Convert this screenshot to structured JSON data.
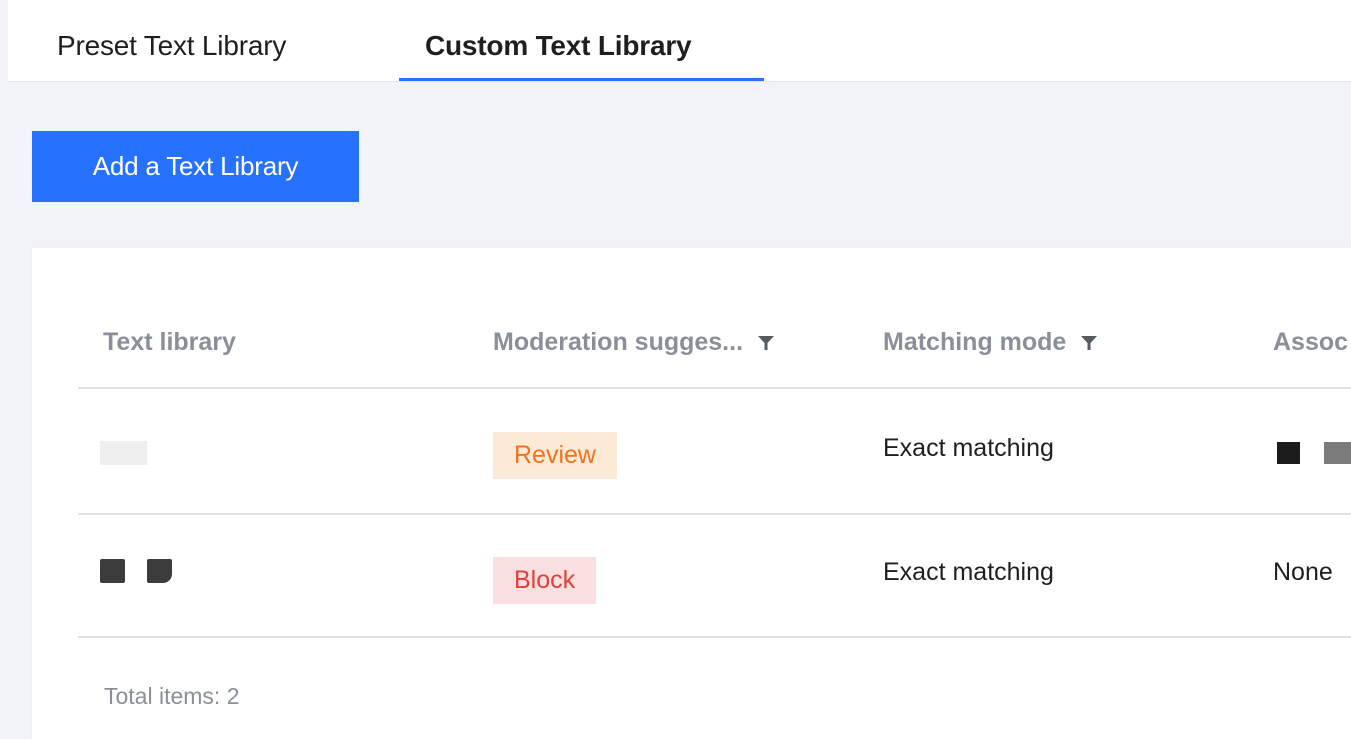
{
  "tabs": [
    {
      "label": "Preset Text Library",
      "active": false
    },
    {
      "label": "Custom Text Library",
      "active": true
    }
  ],
  "toolbar": {
    "add_label": "Add a Text Library"
  },
  "table": {
    "columns": [
      {
        "label": "Text library",
        "filterable": false
      },
      {
        "label": "Moderation sugges...",
        "filterable": true
      },
      {
        "label": "Matching mode",
        "filterable": true
      },
      {
        "label": "Assoc",
        "filterable": false
      }
    ],
    "rows": [
      {
        "suggestion": "Review",
        "matching_mode": "Exact matching",
        "associated": ""
      },
      {
        "suggestion": "Block",
        "matching_mode": "Exact matching",
        "associated": "None"
      }
    ]
  },
  "footer": {
    "total_label": "Total items:  2"
  },
  "colors": {
    "accent": "#2771ff",
    "review_bg": "#fce9d6",
    "review_text": "#f0731e",
    "block_bg": "#f9dfdf",
    "block_text": "#e0403c"
  },
  "icons": {
    "filter": "filter-icon"
  }
}
